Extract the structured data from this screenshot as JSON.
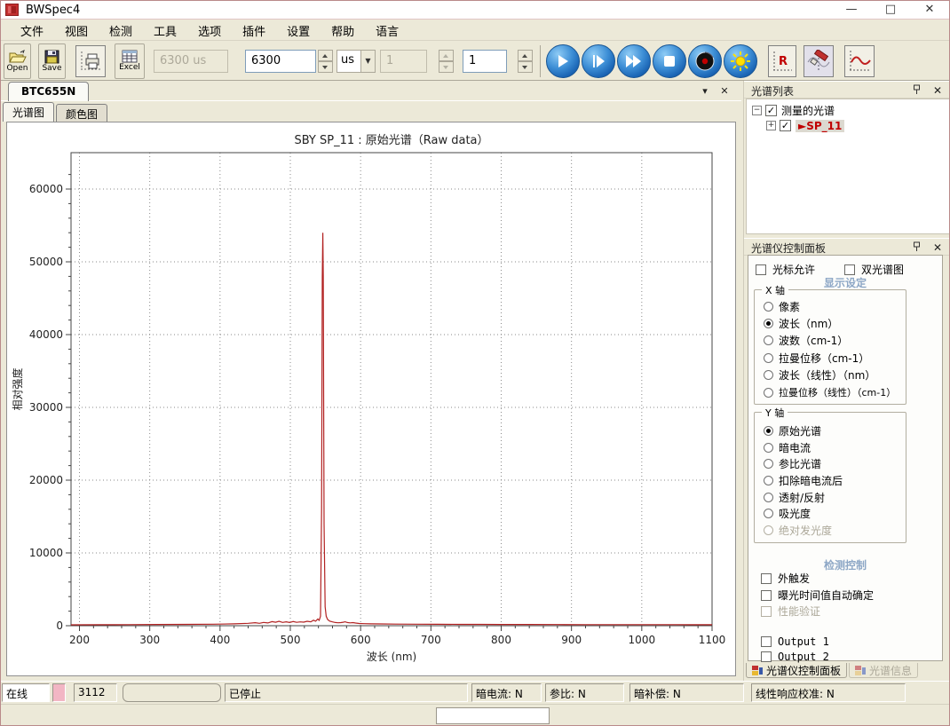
{
  "window": {
    "title": "BWSpec4",
    "controls": {
      "minimize": "—",
      "maximize": "□",
      "close": "✕"
    }
  },
  "menu": [
    "文件",
    "视图",
    "检测",
    "工具",
    "选项",
    "插件",
    "设置",
    "帮助",
    "语言"
  ],
  "toolbar": {
    "open_label": "Open",
    "save_label": "Save",
    "excel_label": "Excel",
    "exposure_display": "6300 us",
    "exposure_value": "6300",
    "unit_value": "us",
    "average_disabled_value": "1",
    "average_value": "1"
  },
  "tabs": {
    "document": "BTC655N",
    "view_spectrum": "光谱图",
    "view_color": "颜色图"
  },
  "icons": {
    "caret_down": "▾",
    "close": "✕",
    "check": "✓",
    "collapse": "−",
    "expand": "+",
    "dropdown_arrow": "▼"
  },
  "spectra_list": {
    "title": "光谱列表",
    "root_label": "测量的光谱",
    "item_label": "►SP_11"
  },
  "control_panel": {
    "title": "光谱仪控制面板",
    "cursor_checkbox": "光标允许",
    "dual_checkbox": "双光谱图",
    "display_header": "显示设定",
    "x_group": "X 轴",
    "x_options": [
      "像素",
      "波长（nm）",
      "波数（cm-1）",
      "拉曼位移（cm-1）",
      "波长（线性）（nm）",
      "拉曼位移（线性）（cm-1）"
    ],
    "x_selected": "波长（nm）",
    "y_group": "Y 轴",
    "y_options": [
      "原始光谱",
      "暗电流",
      "参比光谱",
      "扣除暗电流后",
      "透射/反射",
      "吸光度",
      "绝对发光度"
    ],
    "y_selected": "原始光谱",
    "detect_header": "检测控制",
    "detect_options": [
      "外触发",
      "曝光时间值自动确定",
      "性能验证"
    ],
    "output_options": [
      "Output 1",
      "Output 2"
    ],
    "tab_control": "光谱仪控制面板",
    "tab_info": "光谱信息"
  },
  "status": {
    "online": "在线",
    "code": "3112",
    "state": "已停止",
    "dark_current": "暗电流: N",
    "reference": "参比: N",
    "dark_comp": "暗补偿: N",
    "linearity": "线性响应校准: N"
  },
  "chart_data": {
    "type": "line",
    "title": "SBY  SP_11 : 原始光谱（Raw data）",
    "xlabel": "波长 (nm)",
    "ylabel": "相对强度",
    "xlim": [
      188,
      1100
    ],
    "ylim": [
      0,
      65000
    ],
    "x_ticks": [
      200,
      300,
      400,
      500,
      600,
      700,
      800,
      900,
      1000,
      1100
    ],
    "y_ticks": [
      0,
      10000,
      20000,
      30000,
      40000,
      50000,
      60000
    ],
    "x_minor_step": 20,
    "y_minor_step": 2000,
    "grid": "dotted",
    "line_color": "#b22222",
    "peak": {
      "wavelength": 546,
      "intensity": 54000
    },
    "series": [
      {
        "name": "SP_11",
        "points": [
          [
            188,
            120
          ],
          [
            230,
            130
          ],
          [
            270,
            150
          ],
          [
            310,
            165
          ],
          [
            350,
            180
          ],
          [
            390,
            210
          ],
          [
            420,
            260
          ],
          [
            440,
            330
          ],
          [
            450,
            420
          ],
          [
            456,
            330
          ],
          [
            462,
            450
          ],
          [
            468,
            380
          ],
          [
            474,
            560
          ],
          [
            479,
            470
          ],
          [
            484,
            610
          ],
          [
            489,
            450
          ],
          [
            494,
            540
          ],
          [
            499,
            440
          ],
          [
            504,
            570
          ],
          [
            509,
            460
          ],
          [
            514,
            530
          ],
          [
            519,
            490
          ],
          [
            524,
            610
          ],
          [
            529,
            540
          ],
          [
            533,
            760
          ],
          [
            536,
            620
          ],
          [
            539,
            920
          ],
          [
            541,
            740
          ],
          [
            543,
            1300
          ],
          [
            544.5,
            16000
          ],
          [
            545.5,
            48000
          ],
          [
            546.2,
            54000
          ],
          [
            546.9,
            48000
          ],
          [
            548,
            14000
          ],
          [
            549.5,
            2600
          ],
          [
            551,
            1300
          ],
          [
            553,
            850
          ],
          [
            556,
            640
          ],
          [
            560,
            520
          ],
          [
            564,
            440
          ],
          [
            568,
            400
          ],
          [
            572,
            430
          ],
          [
            575,
            470
          ],
          [
            578,
            540
          ],
          [
            581,
            440
          ],
          [
            585,
            390
          ],
          [
            589,
            430
          ],
          [
            593,
            360
          ],
          [
            598,
            310
          ],
          [
            605,
            280
          ],
          [
            615,
            260
          ],
          [
            630,
            240
          ],
          [
            650,
            220
          ],
          [
            680,
            205
          ],
          [
            710,
            195
          ],
          [
            740,
            185
          ],
          [
            770,
            180
          ],
          [
            800,
            172
          ],
          [
            840,
            165
          ],
          [
            880,
            158
          ],
          [
            920,
            152
          ],
          [
            960,
            148
          ],
          [
            1000,
            145
          ],
          [
            1040,
            142
          ],
          [
            1070,
            140
          ],
          [
            1100,
            138
          ]
        ]
      }
    ]
  }
}
